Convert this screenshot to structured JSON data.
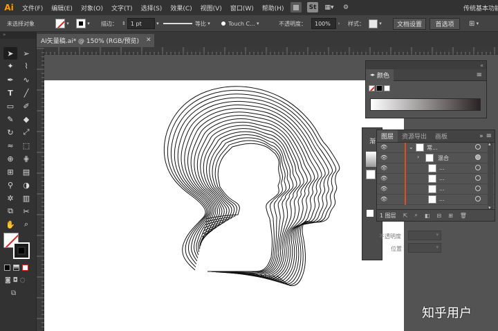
{
  "app": {
    "logo": "Ai",
    "workspace": "传统基本功能",
    "menu": [
      "文件(F)",
      "编辑(E)",
      "对象(O)",
      "文字(T)",
      "选择(S)",
      "效果(C)",
      "视图(V)",
      "窗口(W)",
      "帮助(H)"
    ],
    "menu_icons": [
      "bridge-icon",
      "stock-icon",
      "arrange-documents-icon",
      "gpu-performance-icon"
    ],
    "menu_icon_text": {
      "stock": "St"
    }
  },
  "control_bar": {
    "selection_label": "未选择对象",
    "stroke_label": "描边：",
    "stroke_weight": "1 pt",
    "stroke_profile": "等比",
    "brush": "Touch C...",
    "opacity_label": "不透明度：",
    "opacity_value": "100%",
    "style_label": "样式：",
    "doc_setup_button": "文档设置",
    "preferences_button": "首选项"
  },
  "document": {
    "tab_title": "AI矢量稿.ai* @ 150% (RGB/预览)",
    "close_glyph": "✕"
  },
  "panels": {
    "color": {
      "tab": "颜色",
      "controls": "«"
    },
    "layers": {
      "tabs": [
        "图层",
        "资源导出",
        "画板"
      ],
      "active_tab": "图层",
      "controls": "»",
      "rows": [
        {
          "name": "常...",
          "expanded": true,
          "indent": 0
        },
        {
          "name": "混合",
          "expanded": false,
          "indent": 1
        },
        {
          "name": "...",
          "indent": 2
        },
        {
          "name": "...",
          "indent": 2
        },
        {
          "name": "...",
          "indent": 2
        },
        {
          "name": "...",
          "indent": 2
        }
      ],
      "footer_label": "1 图层"
    },
    "behind_panel": {
      "title_fragment": "渐",
      "labels": [
        "不透明度",
        "位置"
      ]
    }
  },
  "toolbar": {
    "tools": [
      "selection-tool",
      "direct-selection-tool",
      "magic-wand-tool",
      "lasso-tool",
      "pen-tool",
      "curvature-tool",
      "type-tool",
      "line-tool",
      "rectangle-tool",
      "paintbrush-tool",
      "shaper-tool",
      "eraser-tool",
      "rotate-tool",
      "scale-tool",
      "width-tool",
      "free-transform-tool",
      "shape-builder-tool",
      "perspective-grid-tool",
      "mesh-tool",
      "gradient-tool",
      "eyedropper-tool",
      "blend-tool",
      "symbol-sprayer-tool",
      "column-graph-tool",
      "artboard-tool",
      "slice-tool",
      "hand-tool",
      "zoom-tool"
    ]
  },
  "watermark": "知乎用户"
}
